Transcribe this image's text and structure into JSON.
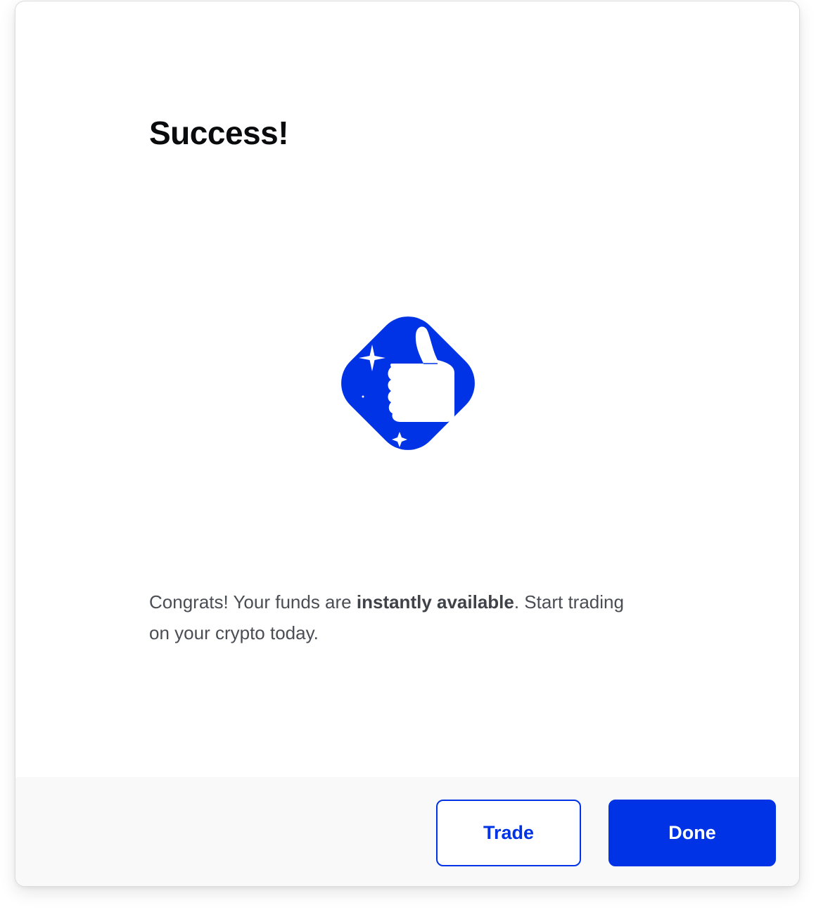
{
  "dialog": {
    "title": "Success!",
    "message_before": "Congrats! Your funds are ",
    "message_bold": "instantly available",
    "message_after": ". Start trading on your crypto today.",
    "illustration_icon": "thumbs-up-icon",
    "illustration_color": "#0033e6"
  },
  "footer": {
    "trade_label": "Trade",
    "done_label": "Done"
  },
  "colors": {
    "accent": "#0033e6",
    "footer_bg": "#f9f9f9",
    "text_primary": "#0a0b0d",
    "text_secondary": "#4a4d54"
  }
}
